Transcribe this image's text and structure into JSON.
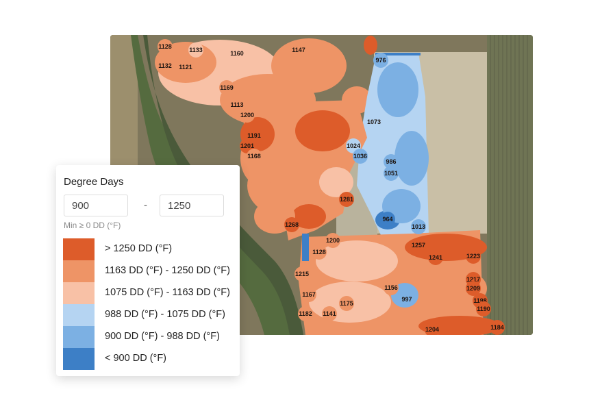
{
  "filter": {
    "title": "Degree Days",
    "min_value": "900",
    "max_value": "1250",
    "separator": "-",
    "hint": "Min ≥ 0 DD (°F)"
  },
  "legend": [
    {
      "label": "> 1250 DD (°F)",
      "color": "#dd5c2a"
    },
    {
      "label": "1163 DD (°F) - 1250 DD (°F)",
      "color": "#ee9466"
    },
    {
      "label": "1075 DD (°F) - 1163 DD (°F)",
      "color": "#f8c1a6"
    },
    {
      "label": "988 DD (°F) - 1075 DD (°F)",
      "color": "#b5d4f2"
    },
    {
      "label": "900 DD (°F) - 988 DD (°F)",
      "color": "#7cb0e3"
    },
    {
      "label": "< 900 DD (°F)",
      "color": "#3d7fc6"
    }
  ],
  "map_points": [
    {
      "value": "1128",
      "cls": 1
    },
    {
      "value": "1160",
      "cls": 2
    },
    {
      "value": "1133",
      "cls": 2
    },
    {
      "value": "1147",
      "cls": 1
    },
    {
      "value": "1132",
      "cls": 1
    },
    {
      "value": "1121",
      "cls": 1
    },
    {
      "value": "1169",
      "cls": 1
    },
    {
      "value": "976",
      "cls": 4
    },
    {
      "value": "1113",
      "cls": 1
    },
    {
      "value": "1200",
      "cls": 1
    },
    {
      "value": "1191",
      "cls": 0
    },
    {
      "value": "1201",
      "cls": 0
    },
    {
      "value": "1168",
      "cls": 1
    },
    {
      "value": "1268",
      "cls": 0
    },
    {
      "value": "1281",
      "cls": 0
    },
    {
      "value": "1073",
      "cls": 3
    },
    {
      "value": "1024",
      "cls": 3
    },
    {
      "value": "986",
      "cls": 4
    },
    {
      "value": "1036",
      "cls": 4
    },
    {
      "value": "964",
      "cls": 5
    },
    {
      "value": "1013",
      "cls": 4
    },
    {
      "value": "1051",
      "cls": 4
    },
    {
      "value": "1200",
      "cls": 1
    },
    {
      "value": "1128",
      "cls": 1
    },
    {
      "value": "1215",
      "cls": 1
    },
    {
      "value": "1167",
      "cls": 1
    },
    {
      "value": "1182",
      "cls": 1
    },
    {
      "value": "1257",
      "cls": 0
    },
    {
      "value": "1241",
      "cls": 0
    },
    {
      "value": "1223",
      "cls": 0
    },
    {
      "value": "1217",
      "cls": 0
    },
    {
      "value": "1209",
      "cls": 0
    },
    {
      "value": "1198",
      "cls": 0
    },
    {
      "value": "1190",
      "cls": 0
    },
    {
      "value": "1204",
      "cls": 0
    },
    {
      "value": "1184",
      "cls": 0
    },
    {
      "value": "1156",
      "cls": 1
    },
    {
      "value": "997",
      "cls": 4
    },
    {
      "value": "1175",
      "cls": 1
    },
    {
      "value": "1141",
      "cls": 1
    }
  ]
}
